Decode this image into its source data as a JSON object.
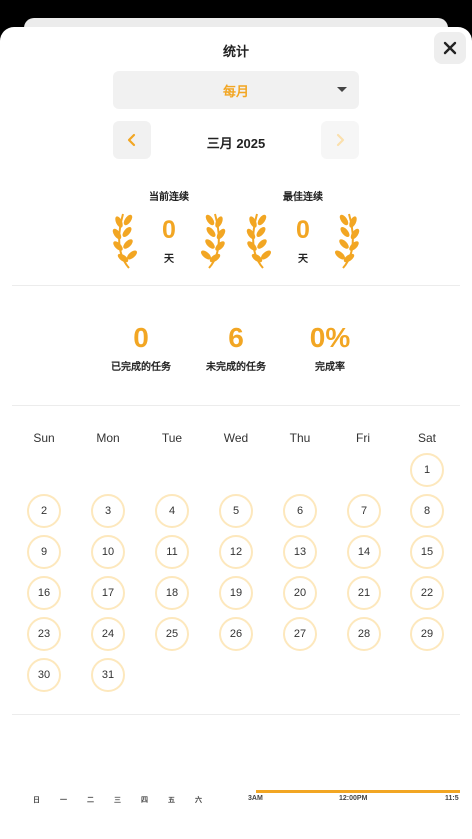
{
  "header": {
    "title": "统计"
  },
  "period": {
    "selected": "每月"
  },
  "nav": {
    "month_label": "三月 2025",
    "prev_icon": "chevron-left-icon",
    "next_icon": "chevron-right-icon"
  },
  "streaks": {
    "current": {
      "label": "当前连续",
      "value": "0",
      "unit": "天"
    },
    "best": {
      "label": "最佳连续",
      "value": "0",
      "unit": "天"
    }
  },
  "stats": [
    {
      "value": "0",
      "label": "已完成的任务"
    },
    {
      "value": "6",
      "label": "未完成的任务"
    },
    {
      "value": "0%",
      "label": "完成率"
    }
  ],
  "calendar": {
    "weekdays": [
      "Sun",
      "Mon",
      "Tue",
      "Wed",
      "Thu",
      "Fri",
      "Sat"
    ],
    "first_weekday_index": 6,
    "days_in_month": 31
  },
  "bottom": {
    "weekday_labels": [
      "日",
      "一",
      "二",
      "三",
      "四",
      "五",
      "六"
    ],
    "time_labels": [
      "3AM",
      "12:00PM",
      "11:5"
    ]
  },
  "colors": {
    "accent": "#f2a623",
    "day_ring": "#fde8bd"
  }
}
